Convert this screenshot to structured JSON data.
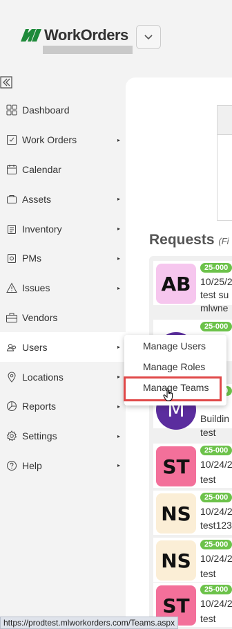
{
  "header": {
    "logo_text": "WorkOrders",
    "logo_mark_color": "#1e8a3a"
  },
  "sidebar": {
    "items": [
      {
        "label": "Dashboard",
        "icon": "dashboard-icon",
        "has_arrow": false
      },
      {
        "label": "Work Orders",
        "icon": "work-orders-icon",
        "has_arrow": true
      },
      {
        "label": "Calendar",
        "icon": "calendar-icon",
        "has_arrow": false
      },
      {
        "label": "Assets",
        "icon": "assets-icon",
        "has_arrow": true
      },
      {
        "label": "Inventory",
        "icon": "inventory-icon",
        "has_arrow": true
      },
      {
        "label": "PMs",
        "icon": "pms-icon",
        "has_arrow": true
      },
      {
        "label": "Issues",
        "icon": "issues-icon",
        "has_arrow": true
      },
      {
        "label": "Vendors",
        "icon": "vendors-icon",
        "has_arrow": false
      },
      {
        "label": "Users",
        "icon": "users-icon",
        "has_arrow": true,
        "active": true
      },
      {
        "label": "Locations",
        "icon": "locations-icon",
        "has_arrow": true
      },
      {
        "label": "Reports",
        "icon": "reports-icon",
        "has_arrow": true
      },
      {
        "label": "Settings",
        "icon": "settings-icon",
        "has_arrow": true
      },
      {
        "label": "Help",
        "icon": "help-icon",
        "has_arrow": true
      }
    ],
    "arrow": "▸"
  },
  "users_menu": {
    "items": [
      "Manage Users",
      "Manage Roles",
      "Manage Teams"
    ],
    "highlighted": "Manage Teams",
    "highlight_color": "#e04848"
  },
  "requests": {
    "title": "Requests",
    "title_suffix": "(Fi",
    "badge_color": "#6cc24a",
    "cards": [
      {
        "initials": "AB",
        "avatar_color": "#f6c6ee",
        "round": false,
        "badge": "25-000",
        "lines": [
          "10/25/2",
          "test su",
          "mlwne"
        ]
      },
      {
        "initials": "",
        "avatar_color": "#5b2d9e",
        "round": true,
        "badge": "25-000",
        "lines": [
          "",
          "",
          ""
        ]
      },
      {
        "initials": "M",
        "avatar_color": "#5b2d9e",
        "round": true,
        "badge": "25-000",
        "lines": [
          "",
          "Buildin",
          "test"
        ]
      },
      {
        "initials": "ST",
        "avatar_color": "#f3709a",
        "round": false,
        "badge": "25-000",
        "lines": [
          "10/24/2",
          "test"
        ]
      },
      {
        "initials": "NS",
        "avatar_color": "#fbeed6",
        "round": false,
        "badge": "25-000",
        "lines": [
          "10/24/2",
          "test123"
        ]
      },
      {
        "initials": "NS",
        "avatar_color": "#fbeed6",
        "round": false,
        "badge": "25-000",
        "lines": [
          "10/24/2",
          "test"
        ]
      },
      {
        "initials": "ST",
        "avatar_color": "#f3709a",
        "round": false,
        "badge": "25-000",
        "lines": [
          "10/24/2",
          "test"
        ]
      }
    ]
  },
  "status_url": "https://prodtest.mlworkorders.com/Teams.aspx"
}
